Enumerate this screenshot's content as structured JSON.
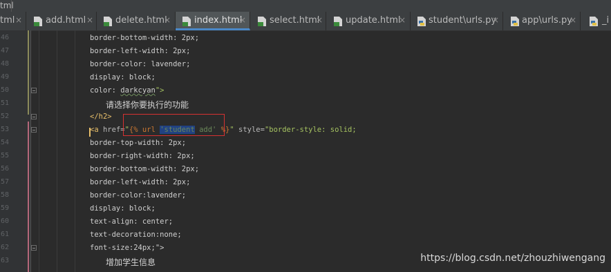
{
  "breadcrumb": {
    "label": "tml"
  },
  "tabs": [
    {
      "label": "tml",
      "type": "html",
      "active": false
    },
    {
      "label": "add.html",
      "type": "html",
      "active": false
    },
    {
      "label": "delete.html",
      "type": "html",
      "active": false
    },
    {
      "label": "index.html",
      "type": "html",
      "active": true
    },
    {
      "label": "select.html",
      "type": "html",
      "active": false
    },
    {
      "label": "update.html",
      "type": "html",
      "active": false
    },
    {
      "label": "student\\urls.py",
      "type": "py",
      "active": false
    },
    {
      "label": "app\\urls.py",
      "type": "py",
      "active": false
    },
    {
      "label": "_i",
      "type": "py",
      "active": false
    }
  ],
  "tab_close_glyph": "×",
  "line_numbers": [
    "46",
    "47",
    "48",
    "49",
    "50",
    "51",
    "52",
    "53",
    "54",
    "55",
    "56",
    "57",
    "58",
    "59",
    "60",
    "61",
    "62",
    "63"
  ],
  "code": {
    "l46": "border-bottom-width: 2px;",
    "l47": "border-left-width: 2px;",
    "l48": "border-color: lavender;",
    "l49": "display: block;",
    "l50_a": "color: ",
    "l50_b": "darkcyan",
    "l50_c": "\">",
    "l51": "请选择你要执行的功能",
    "l52": "</h2>",
    "l53_tag": "<a",
    "l53_attr": " href=",
    "l53_q1": "\"",
    "l53_t1": "{% url ",
    "l53_name1": "'student",
    "l53_name2": "add'",
    "l53_t2": " %}",
    "l53_q2": "\"",
    "l53_rest_attr": " style=",
    "l53_rest": "\"border-style: solid;",
    "l54": "border-top-width: 2px;",
    "l55": "border-right-width: 2px;",
    "l56": "border-bottom-width: 2px;",
    "l57": "border-left-width: 2px;",
    "l58": "border-color:lavender;",
    "l59": "display: block;",
    "l60": "text-align: center;",
    "l61": "text-decoration:none;",
    "l62": "font-size:24px;\">",
    "l63": "增加学生信息"
  },
  "watermark": "https://blog.csdn.net/zhouzhiwengang",
  "colors": {
    "active_tab_underline": "#4a88c7",
    "highlight_box": "#d83131",
    "tag": "#e8bf6a",
    "string": "#a5c261"
  }
}
